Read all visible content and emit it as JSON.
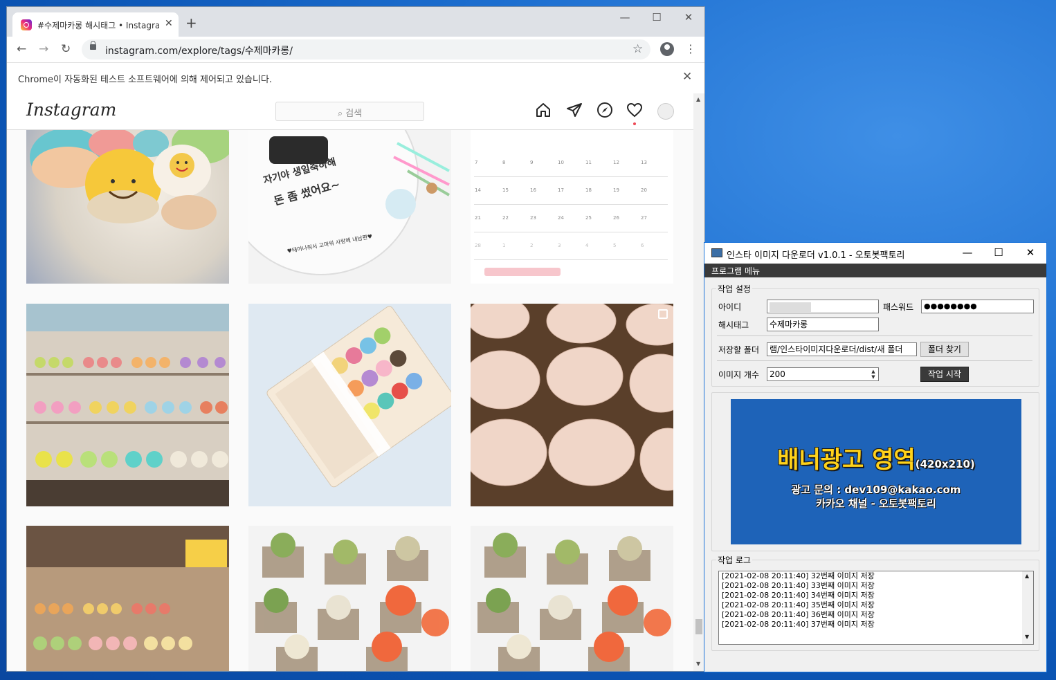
{
  "chrome": {
    "tab_title": "#수제마카롱 해시태그 • Instagram",
    "url": "instagram.com/explore/tags/수제마카롱/",
    "infobar_message": "Chrome이 자동화된 테스트 소프트웨어에 의해 제어되고 있습니다."
  },
  "instagram": {
    "logo": "Instagram",
    "search_placeholder": "검색"
  },
  "calendar": {
    "rows": [
      [
        "7",
        "8",
        "9",
        "10",
        "11",
        "12",
        "13"
      ],
      [
        "14",
        "15",
        "16",
        "17",
        "18",
        "19",
        "20"
      ],
      [
        "21",
        "22",
        "23",
        "24",
        "25",
        "26",
        "27"
      ],
      [
        "28",
        "1",
        "2",
        "3",
        "4",
        "5",
        "6"
      ]
    ]
  },
  "cake_text": {
    "line1": "자기야 생일축하해",
    "line2": "돈 좀 썼어요~",
    "bottom": "♥태어나줘서 고마워 사랑해 내남편♥"
  },
  "app": {
    "title": "인스타 이미지 다운로더 v1.0.1 - 오토봇팩토리",
    "menu": "프로그램 메뉴",
    "settings_group": "작업 설정",
    "id_label": "아이디",
    "password_label": "패스워드",
    "password_value": "●●●●●●●●",
    "hashtag_label": "해시태그",
    "hashtag_value": "수제마카롱",
    "folder_label": "저장할 폴더",
    "folder_value": "램/인스타이미지다운로더/dist/새 폴더",
    "folder_button": "폴더 찾기",
    "count_label": "이미지 개수",
    "count_value": "200",
    "start_button": "작업 시작",
    "banner": {
      "headline": "배너광고 영역",
      "size": "(420x210)",
      "contact": "광고 문의 : dev109@kakao.com",
      "channel": "카카오 채널 - 오토봇팩토리"
    },
    "log_group": "작업 로그",
    "log_lines": [
      "[2021-02-08 20:11:40] 32번째 이미지 저장",
      "[2021-02-08 20:11:40] 33번째 이미지 저장",
      "[2021-02-08 20:11:40] 34번째 이미지 저장",
      "[2021-02-08 20:11:40] 35번째 이미지 저장",
      "[2021-02-08 20:11:40] 36번째 이미지 저장",
      "[2021-02-08 20:11:40] 37번째 이미지 저장"
    ]
  },
  "colors": {
    "ig_accent": "#ed4956",
    "app_menubar": "#3a3a3a",
    "banner_bg": "#1e63b8",
    "banner_yellow": "#ffd21a"
  }
}
